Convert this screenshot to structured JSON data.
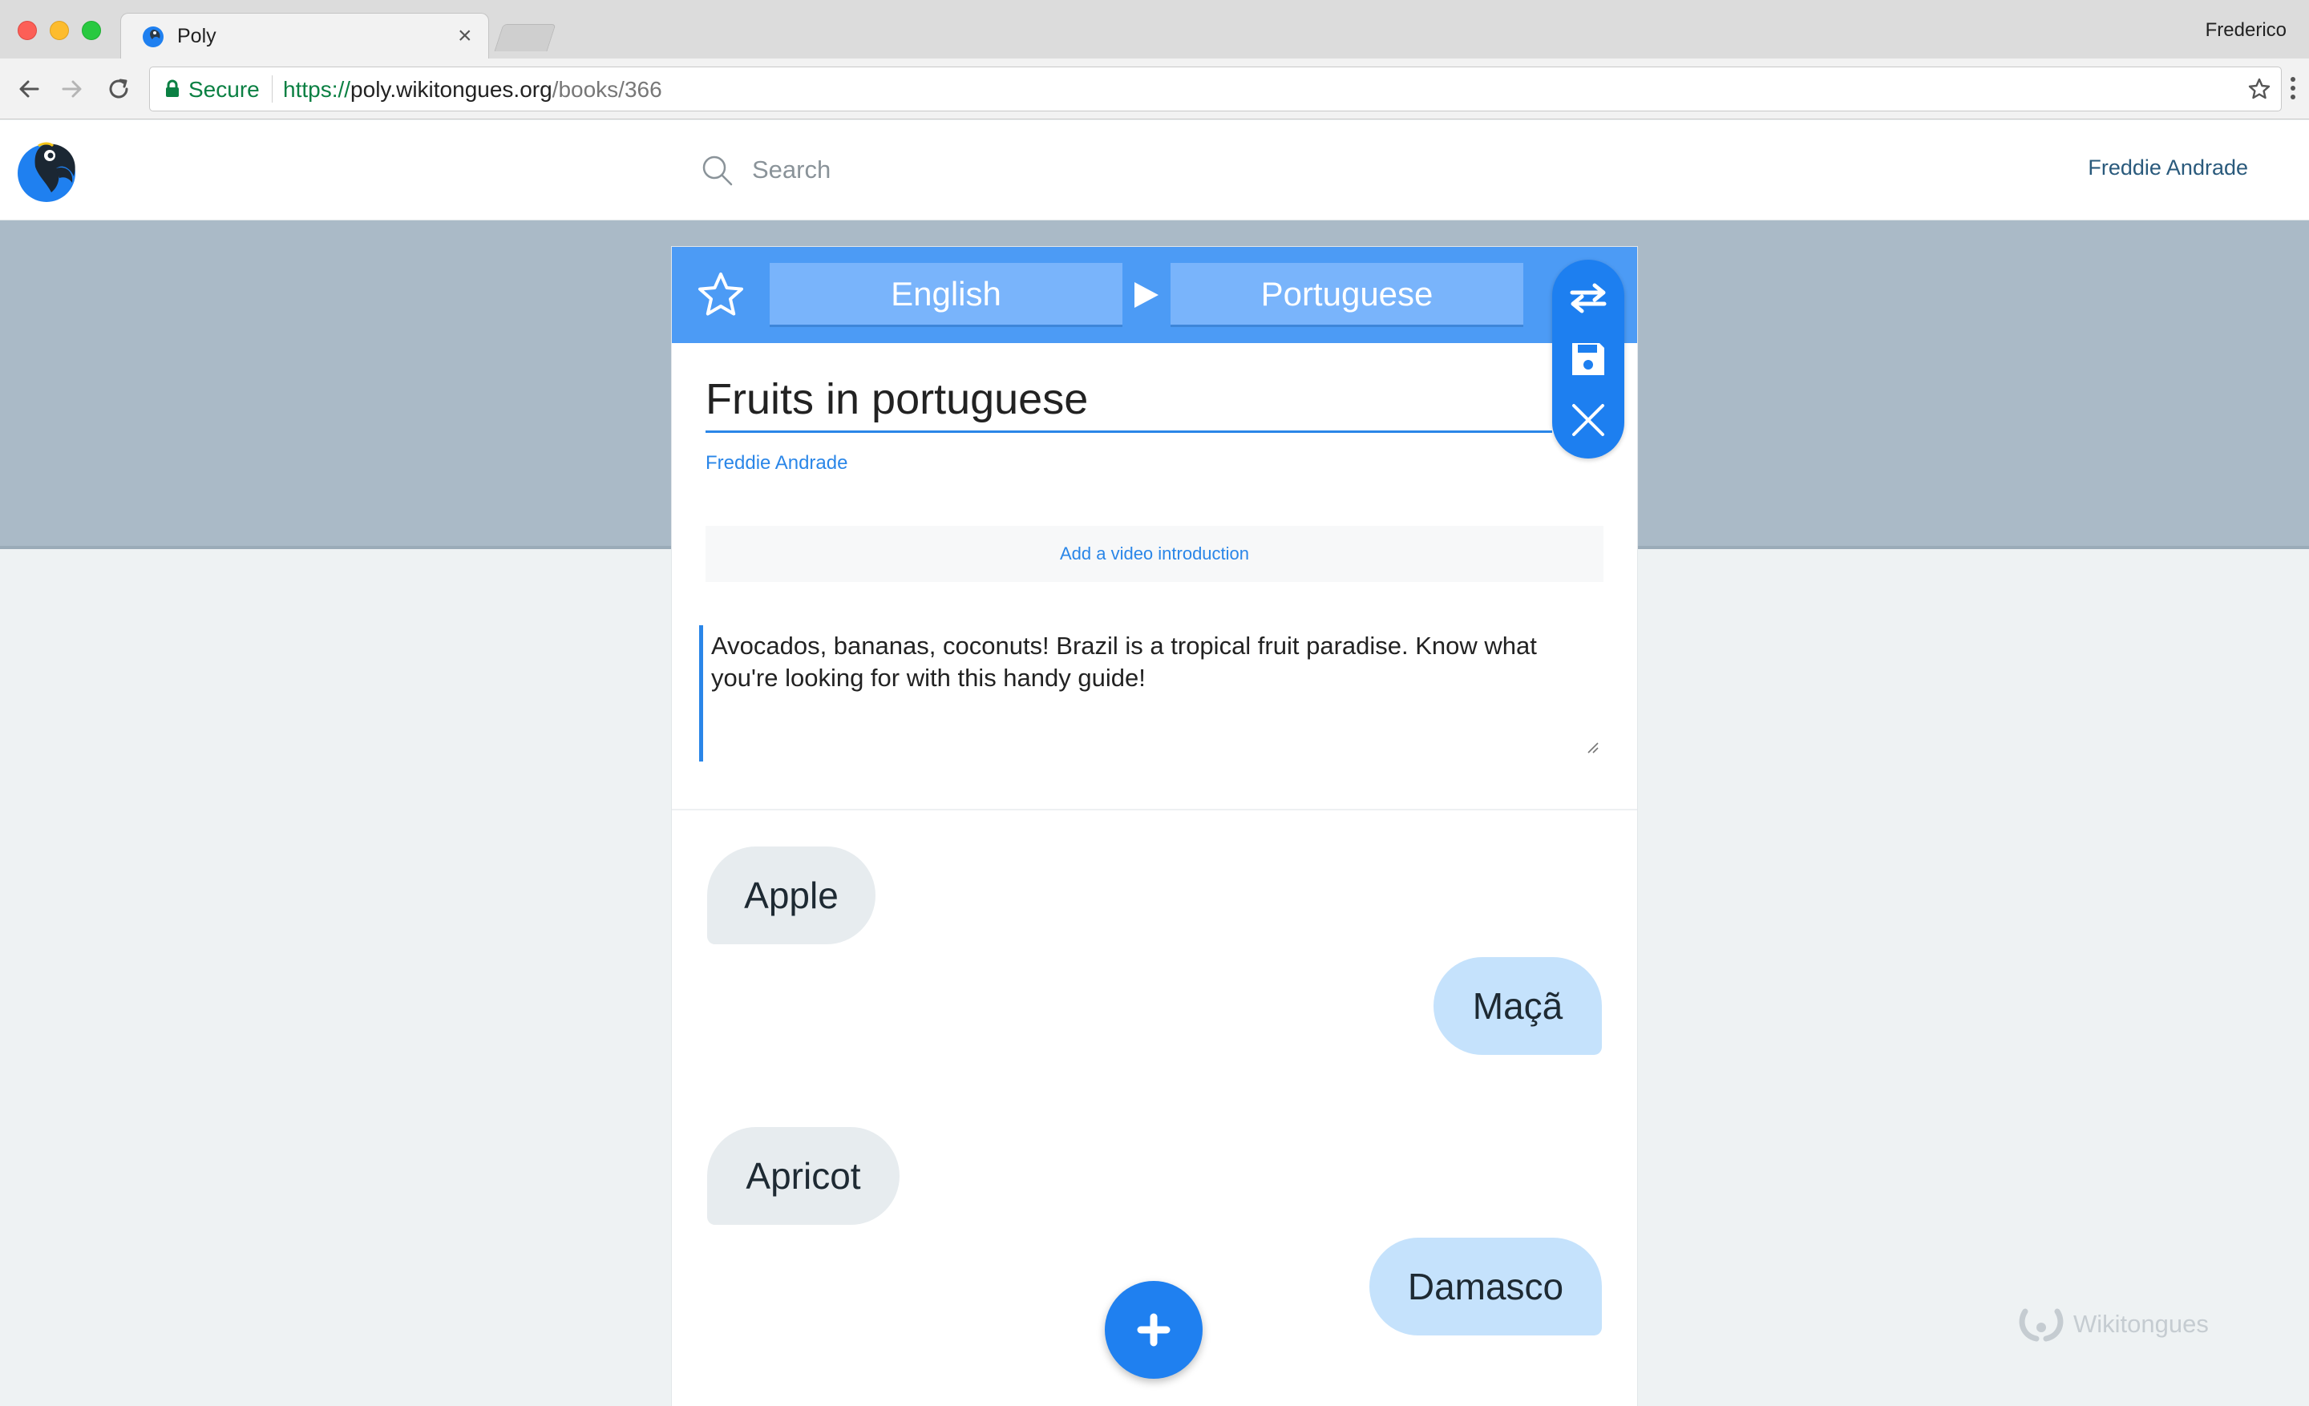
{
  "browser": {
    "tab_title": "Poly",
    "tab_close": "×",
    "profile_name": "Frederico",
    "secure_label": "Secure",
    "url_scheme": "https://",
    "url_host": "poly.wikitongues.org",
    "url_path": "/books/366"
  },
  "header": {
    "search_placeholder": "Search",
    "user_name": "Freddie Andrade"
  },
  "editor": {
    "source_language": "English",
    "target_language": "Portuguese",
    "book_title": "Fruits in portuguese",
    "author": "Freddie Andrade",
    "video_intro_label": "Add a video introduction",
    "description": "Avocados, bananas, coconuts! Brazil is a tropical fruit paradise. Know what you're looking for with this handy guide!",
    "phrases": [
      {
        "source": "Apple",
        "target": "Maçã"
      },
      {
        "source": "Apricot",
        "target": "Damasco"
      }
    ],
    "icons": {
      "favorite": "star-icon",
      "direction": "play-arrow-icon",
      "swap": "swap-arrows-icon",
      "save": "save-icon",
      "close": "close-icon",
      "add": "plus-icon"
    }
  },
  "footer": {
    "watermark": "Wikitongues"
  },
  "colors": {
    "accent": "#4c9bf5",
    "action": "#1d7ff0",
    "band": "#aabac7",
    "source_bubble": "#e7ecef",
    "target_bubble": "#c5e2fc"
  }
}
